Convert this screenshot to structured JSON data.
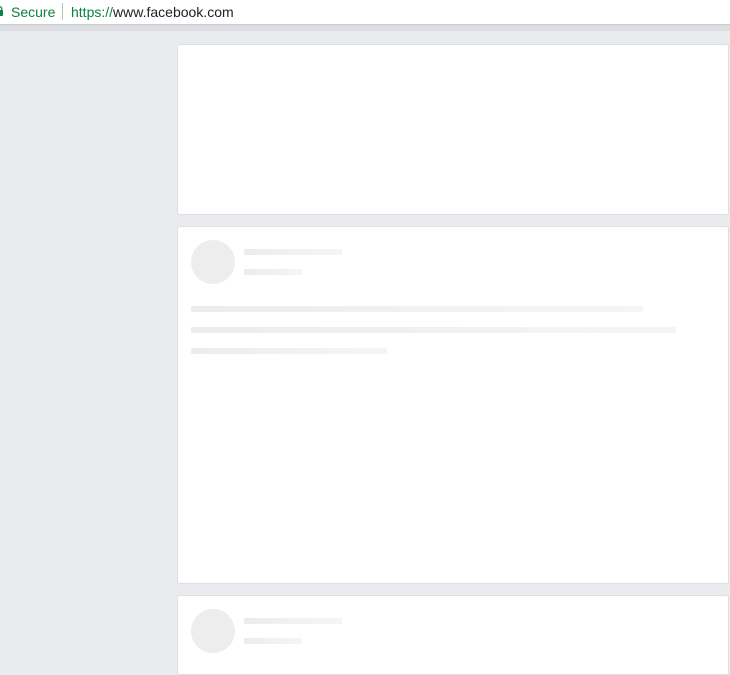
{
  "browser": {
    "secure_label": "Secure",
    "url_scheme": "https://",
    "url_host": "www.facebook.com",
    "lock_icon": "lock-icon",
    "secure_color": "#0b8043"
  },
  "feed": {
    "background_color": "#e9ebee",
    "card_color": "#ffffff",
    "placeholder_color": "#ededee"
  }
}
